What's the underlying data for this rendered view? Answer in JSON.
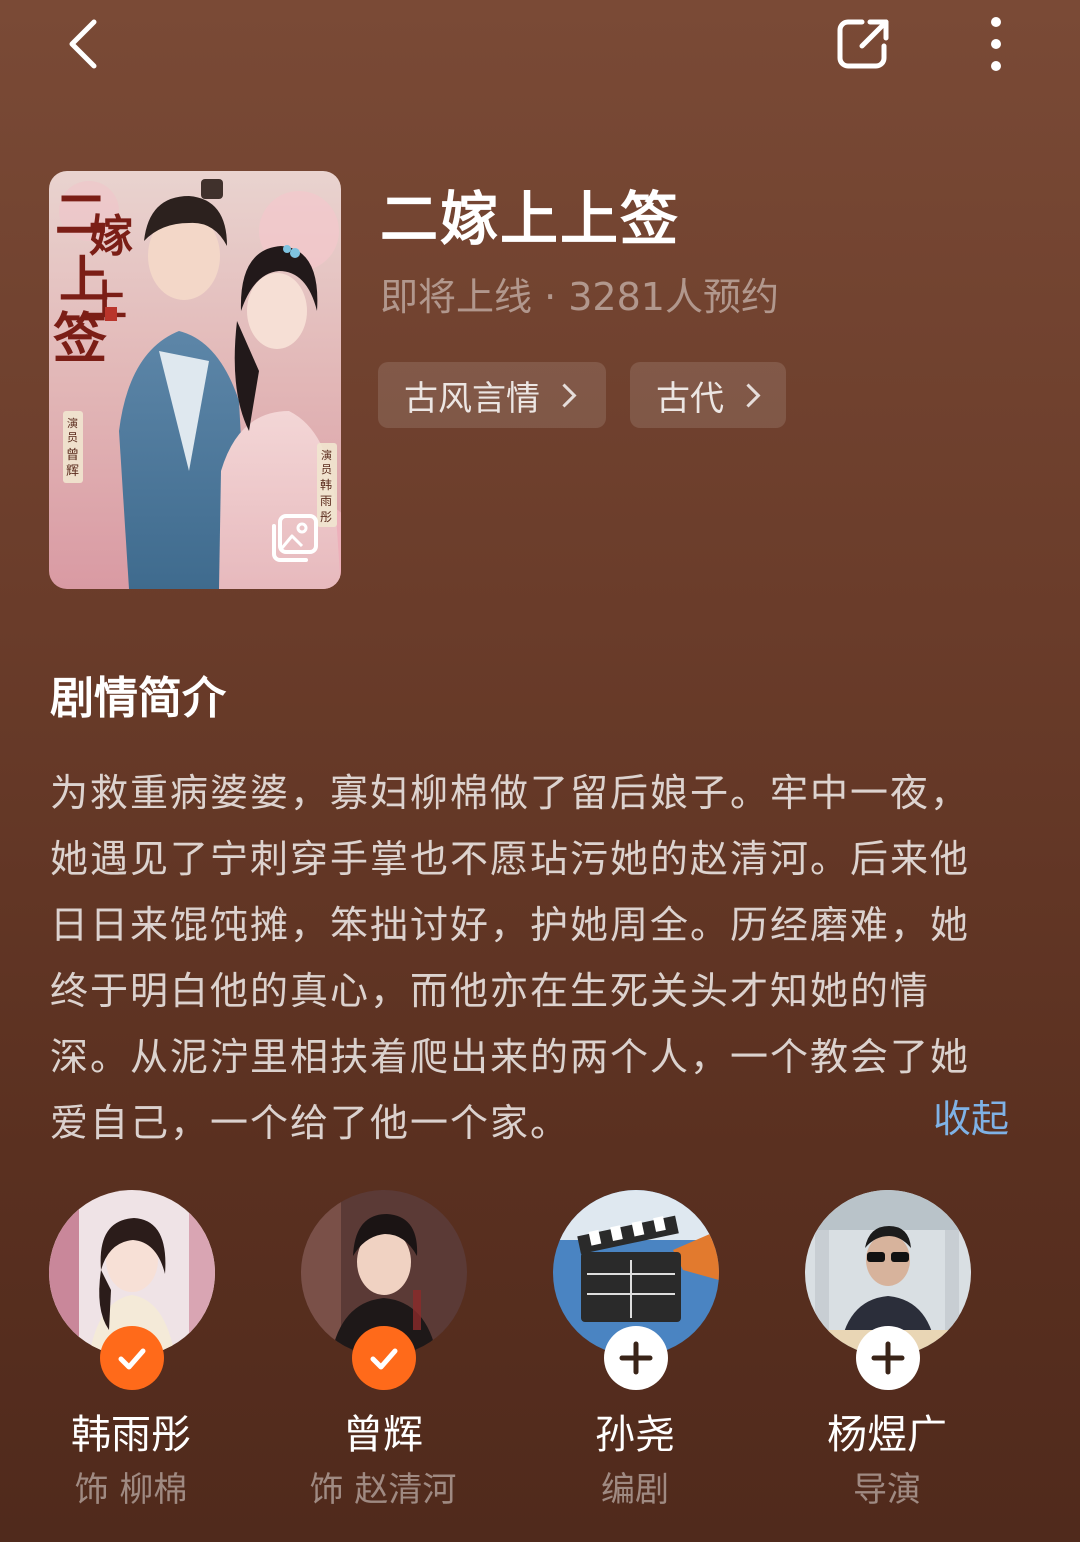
{
  "topbar": {
    "back_icon": "chevron-left-icon",
    "share_icon": "share-icon",
    "more_icon": "more-vertical-icon"
  },
  "drama": {
    "title": "二嫁上上签",
    "subtitle": "即将上线 · 3281人预约",
    "poster": {
      "title_art": "二嫁上上签",
      "cast_labels": [
        "演员 曾辉",
        "演员 韩雨彤"
      ],
      "gallery_icon": "gallery-icon"
    },
    "tags": [
      {
        "label": "古风言情"
      },
      {
        "label": "古代"
      }
    ]
  },
  "synopsis": {
    "heading": "剧情简介",
    "lines": [
      "为救重病婆婆，寡妇柳棉做了留后娘子。牢中一夜，",
      "她遇见了宁刺穿手掌也不愿玷污她的赵清河。后来他",
      "日日来馄饨摊，笨拙讨好，护她周全。历经磨难，她",
      "终于明白他的真心，而他亦在生死关头才知她的情",
      "深。从泥泞里相扶着爬出来的两个人，一个教会了她",
      "爱自己，一个给了他一个家。"
    ],
    "collapse_label": "收起"
  },
  "people": [
    {
      "name": "韩雨彤",
      "role": "饰 柳棉",
      "status": "followed"
    },
    {
      "name": "曾辉",
      "role": "饰 赵清河",
      "status": "followed"
    },
    {
      "name": "孙尧",
      "role": "编剧",
      "status": "add"
    },
    {
      "name": "杨煜广",
      "role": "导演",
      "status": "add"
    }
  ],
  "colors": {
    "accent_orange": "#ff6a1a",
    "link_blue": "#7fb2e6",
    "background_top": "#7a4a36",
    "background_bottom": "#502a1c"
  }
}
